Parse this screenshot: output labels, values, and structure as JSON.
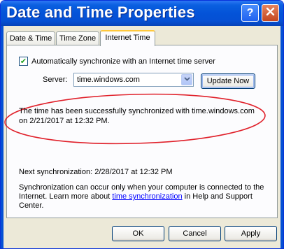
{
  "window": {
    "title": "Date and Time Properties",
    "help_glyph": "?",
    "close_glyph": "✕"
  },
  "tabs": [
    {
      "label": "Date & Time",
      "active": false
    },
    {
      "label": "Time Zone",
      "active": false
    },
    {
      "label": "Internet Time",
      "active": true
    }
  ],
  "internet_time": {
    "auto_sync_label": "Automatically synchronize with an Internet time server",
    "auto_sync_checked": true,
    "check_glyph": "✔",
    "server_label": "Server:",
    "server_value": "time.windows.com",
    "update_button": "Update Now",
    "status_message": "The time has been successfully synchronized with time.windows.com on 2/21/2017 at 12:32 PM.",
    "next_sync": "Next synchronization: 2/28/2017 at 12:32 PM",
    "info_before_link": "Synchronization can occur only when your computer is connected to the Internet.  Learn more about ",
    "info_link": "time synchronization",
    "info_after_link": " in Help and Support Center.",
    "highlight_color": "#e0202a"
  },
  "footer": {
    "ok": "OK",
    "cancel": "Cancel",
    "apply": "Apply"
  }
}
